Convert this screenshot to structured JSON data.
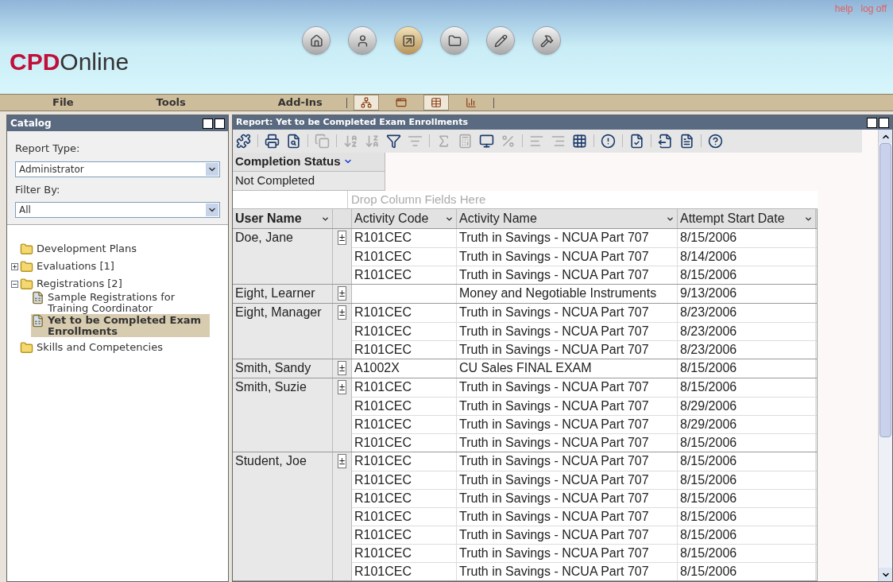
{
  "logo": {
    "bold": "CPD",
    "light": "Online"
  },
  "top_links": [
    "help",
    "log off"
  ],
  "nav_buttons": [
    {
      "kind": "home",
      "selected": false
    },
    {
      "kind": "person",
      "selected": false
    },
    {
      "kind": "report",
      "selected": true
    },
    {
      "kind": "folder",
      "selected": false
    },
    {
      "kind": "pencil",
      "selected": false
    },
    {
      "kind": "hammer",
      "selected": false
    }
  ],
  "menu": [
    "File",
    "Tools",
    "Add-Ins"
  ],
  "view_buttons": [
    {
      "kind": "tree",
      "selected": true
    },
    {
      "kind": "windows",
      "selected": false
    },
    {
      "kind": "table",
      "selected": true
    },
    {
      "kind": "chart",
      "selected": false
    }
  ],
  "catalog": {
    "title": "Catalog",
    "report_type_label": "Report Type:",
    "report_type": "Administrator",
    "filter_label": "Filter By:",
    "filter": "All",
    "tree": [
      {
        "label": "Development Plans",
        "kind": "folder",
        "selected": false
      },
      {
        "label": "Evaluations [1]",
        "kind": "folder",
        "expanded": false,
        "selected": false
      },
      {
        "label": "Registrations [2]",
        "kind": "folder",
        "expanded": true,
        "selected": false,
        "children": [
          {
            "label": "Sample Registrations for Training Coordinator",
            "kind": "report",
            "selected": false
          },
          {
            "label": "Yet to be Completed Exam Enrollments",
            "kind": "report",
            "selected": true
          }
        ]
      },
      {
        "label": "Skills and Competencies",
        "kind": "folder",
        "selected": false
      }
    ]
  },
  "report": {
    "title": "Report: Yet to be Completed Exam Enrollments",
    "toolbar": [
      {
        "kind": "chart",
        "disabled": false
      },
      {
        "kind": "sep"
      },
      {
        "kind": "print",
        "disabled": false
      },
      {
        "kind": "preview",
        "disabled": false
      },
      {
        "kind": "sep"
      },
      {
        "kind": "copy",
        "disabled": true
      },
      {
        "kind": "sep"
      },
      {
        "kind": "sort-asc",
        "disabled": true
      },
      {
        "kind": "sort-desc",
        "disabled": true
      },
      {
        "kind": "filter",
        "disabled": false
      },
      {
        "kind": "filter-list",
        "disabled": true
      },
      {
        "kind": "sep"
      },
      {
        "kind": "sum",
        "disabled": true
      },
      {
        "kind": "calc",
        "disabled": true
      },
      {
        "kind": "field-list",
        "disabled": false
      },
      {
        "kind": "percent",
        "disabled": true
      },
      {
        "kind": "sep"
      },
      {
        "kind": "indent-left",
        "disabled": true
      },
      {
        "kind": "indent-right",
        "disabled": true
      },
      {
        "kind": "grid",
        "disabled": false
      },
      {
        "kind": "sep"
      },
      {
        "kind": "alert",
        "disabled": false
      },
      {
        "kind": "sep"
      },
      {
        "kind": "export",
        "disabled": false
      },
      {
        "kind": "sep"
      },
      {
        "kind": "export-doc",
        "disabled": false
      },
      {
        "kind": "doc",
        "disabled": false
      },
      {
        "kind": "sep"
      },
      {
        "kind": "help",
        "disabled": false
      }
    ],
    "filter_field": "Completion Status",
    "filter_value": "Not Completed",
    "drop_hint": "Drop Column Fields Here",
    "columns": [
      "User Name",
      "Activity Code",
      "Activity Name",
      "Attempt Start Date"
    ],
    "groups": [
      {
        "user": "Doe, Jane",
        "expand": "±",
        "rows": [
          [
            "R101CEC",
            "Truth in Savings - NCUA Part 707",
            "8/15/2006"
          ],
          [
            "R101CEC",
            "Truth in Savings - NCUA Part 707",
            "8/14/2006"
          ],
          [
            "R101CEC",
            "Truth in Savings - NCUA Part 707",
            "8/15/2006"
          ]
        ]
      },
      {
        "user": "Eight, Learner",
        "expand": "±",
        "rows": [
          [
            "",
            "Money and Negotiable Instruments",
            "9/13/2006"
          ]
        ]
      },
      {
        "user": "Eight, Manager",
        "expand": "±",
        "rows": [
          [
            "R101CEC",
            "Truth in Savings - NCUA Part 707",
            "8/23/2006"
          ],
          [
            "R101CEC",
            "Truth in Savings - NCUA Part 707",
            "8/23/2006"
          ],
          [
            "R101CEC",
            "Truth in Savings - NCUA Part 707",
            "8/23/2006"
          ]
        ]
      },
      {
        "user": "Smith, Sandy",
        "expand": "±",
        "rows": [
          [
            "A1002X",
            "CU Sales FINAL EXAM",
            "8/15/2006"
          ]
        ]
      },
      {
        "user": "Smith, Suzie",
        "expand": "±",
        "rows": [
          [
            "R101CEC",
            "Truth in Savings - NCUA Part 707",
            "8/15/2006"
          ],
          [
            "R101CEC",
            "Truth in Savings - NCUA Part 707",
            "8/29/2006"
          ],
          [
            "R101CEC",
            "Truth in Savings - NCUA Part 707",
            "8/29/2006"
          ],
          [
            "R101CEC",
            "Truth in Savings - NCUA Part 707",
            "8/15/2006"
          ]
        ]
      },
      {
        "user": "Student, Joe",
        "expand": "±",
        "rows": [
          [
            "R101CEC",
            "Truth in Savings - NCUA Part 707",
            "8/15/2006"
          ],
          [
            "R101CEC",
            "Truth in Savings - NCUA Part 707",
            "8/15/2006"
          ],
          [
            "R101CEC",
            "Truth in Savings - NCUA Part 707",
            "8/15/2006"
          ],
          [
            "R101CEC",
            "Truth in Savings - NCUA Part 707",
            "8/15/2006"
          ],
          [
            "R101CEC",
            "Truth in Savings - NCUA Part 707",
            "8/15/2006"
          ],
          [
            "R101CEC",
            "Truth in Savings - NCUA Part 707",
            "8/15/2006"
          ],
          [
            "R101CEC",
            "Truth in Savings - NCUA Part 707",
            "8/15/2006"
          ]
        ]
      }
    ]
  }
}
